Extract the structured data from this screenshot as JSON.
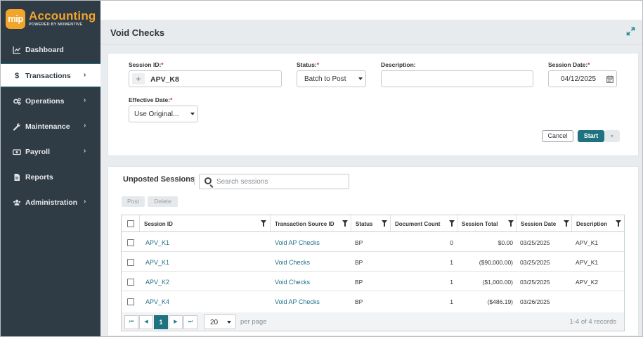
{
  "app": {
    "logo_badge": "mip",
    "logo_title": "Accounting",
    "logo_subtitle": "POWERED BY MOMENTIVE",
    "accent_color": "#1f7280",
    "brand_color": "#f2a52b"
  },
  "sidebar": {
    "items": [
      {
        "label": "Dashboard",
        "icon": "chart-line-icon"
      },
      {
        "label": "Transactions",
        "icon": "dollar-icon",
        "chevron": "›"
      },
      {
        "label": "Operations",
        "icon": "gears-icon",
        "chevron": "›"
      },
      {
        "label": "Maintenance",
        "icon": "wrench-icon",
        "chevron": "›"
      },
      {
        "label": "Payroll",
        "icon": "money-icon",
        "chevron": "›"
      },
      {
        "label": "Reports",
        "icon": "document-icon"
      },
      {
        "label": "Administration",
        "icon": "users-icon",
        "chevron": "›"
      }
    ],
    "active_index": 1
  },
  "page": {
    "title": "Void Checks",
    "expand_icon": "expand-icon"
  },
  "form": {
    "session_id_label": "Session ID:",
    "session_id_value": "APV_K8",
    "status_label": "Status:",
    "status_value": "Batch to Post",
    "description_label": "Description:",
    "description_value": "",
    "session_date_label": "Session Date:",
    "session_date_value": "04/12/2025",
    "effective_date_label": "Effective Date:",
    "effective_date_value": "Use Original...",
    "required_mark": "*",
    "cancel_label": "Cancel",
    "start_label": "Start",
    "start_dropdown": "▾"
  },
  "sessions": {
    "title": "Unposted Sessions",
    "search_placeholder": "Search sessions",
    "post_label": "Post",
    "delete_label": "Delete",
    "columns": [
      "Session ID",
      "Transaction Source ID",
      "Status",
      "Document Count",
      "Session Total",
      "Session Date",
      "Description"
    ],
    "rows": [
      {
        "session_id": "APV_K1",
        "source": "Void AP Checks",
        "status": "BP",
        "count": "0",
        "total": "$0.00",
        "date": "03/25/2025",
        "description": "APV_K1"
      },
      {
        "session_id": "APV_K1",
        "source": "Void Checks",
        "status": "BP",
        "count": "1",
        "total": "($90,000.00)",
        "date": "03/25/2025",
        "description": "APV_K1"
      },
      {
        "session_id": "APV_K2",
        "source": "Void Checks",
        "status": "BP",
        "count": "1",
        "total": "($1,000.00)",
        "date": "03/25/2025",
        "description": "APV_K2"
      },
      {
        "session_id": "APV_K4",
        "source": "Void AP Checks",
        "status": "BP",
        "count": "1",
        "total": "($486.19)",
        "date": "03/26/2025",
        "description": ""
      }
    ],
    "pager": {
      "current_page": "1",
      "page_size": "20",
      "per_page_label": "per page",
      "records_text": "1-4 of 4 records"
    }
  }
}
